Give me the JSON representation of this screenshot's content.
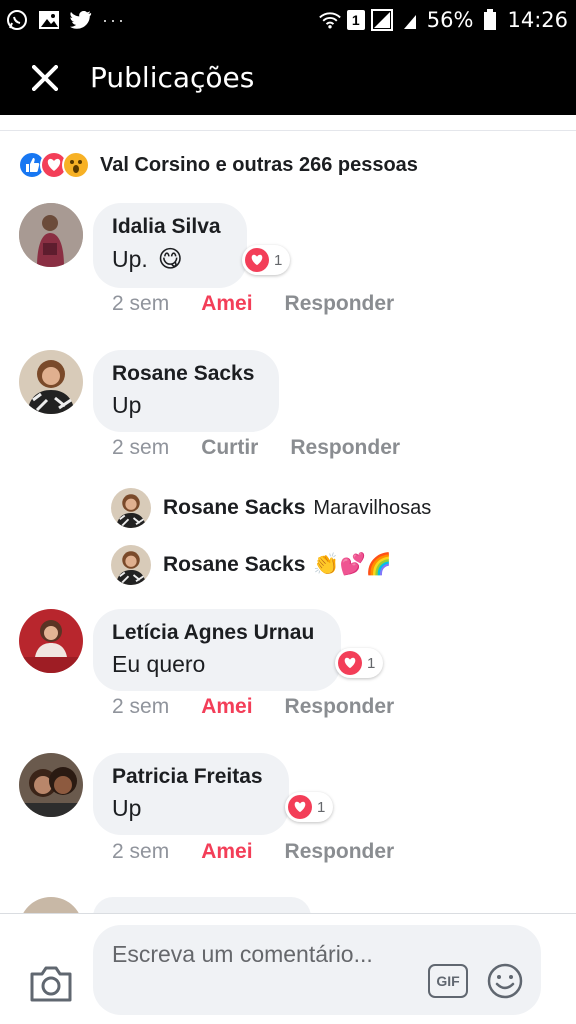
{
  "status_bar": {
    "battery": "56%",
    "time": "14:26",
    "notification_count": "1",
    "overflow": "···"
  },
  "header": {
    "title": "Publicações"
  },
  "reactions_summary": {
    "text": "Val Corsino e outras 266 pessoas",
    "icons": [
      "like-icon",
      "love-icon",
      "wow-icon"
    ]
  },
  "comments": [
    {
      "author": "Idalia Silva",
      "text": "Up.",
      "emoji": "😋",
      "reaction_count": "1",
      "time": "2 sem",
      "reaction_action": "Amei",
      "reply_action": "Responder"
    },
    {
      "author": "Rosane Sacks",
      "text": "Up",
      "time": "2 sem",
      "reaction_action": "Curtir",
      "reply_action": "Responder",
      "replies": [
        {
          "author": "Rosane Sacks",
          "text": "Maravilhosas"
        },
        {
          "author": "Rosane Sacks",
          "text": "👏💕🌈"
        }
      ]
    },
    {
      "author": "Letícia Agnes Urnau",
      "text": "Eu quero",
      "reaction_count": "1",
      "time": "2 sem",
      "reaction_action": "Amei",
      "reply_action": "Responder"
    },
    {
      "author": "Patricia Freitas",
      "text": "Up",
      "reaction_count": "1",
      "time": "2 sem",
      "reaction_action": "Amei",
      "reply_action": "Responder"
    }
  ],
  "composer": {
    "placeholder": "Escreva um comentário...",
    "gif_label": "GIF"
  },
  "colors": {
    "love": "#f33e58",
    "like": "#1877f2",
    "bubble": "#f0f2f5",
    "muted": "#8a8d91"
  }
}
